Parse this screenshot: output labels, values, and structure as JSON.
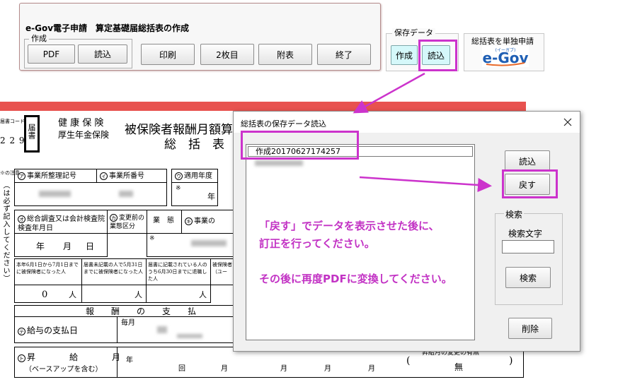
{
  "toolbar": {
    "title": "e-Gov電子申請　算定基礎届総括表の作成",
    "create_group_label": "作成",
    "pdf_label": "PDF",
    "read_label": "読込",
    "print_label": "印刷",
    "two_sheets_label": "2枚目",
    "attachment_label": "附表",
    "exit_label": "終了"
  },
  "save_data": {
    "label": "保存データ",
    "create_label": "作成",
    "read_label": "読込"
  },
  "egov_submit": {
    "label": "総括表を単独申請",
    "logo_text": "e-Gov",
    "logo_subtext": "(イーガブ)"
  },
  "form": {
    "code_label": "届書コード",
    "code_value": "2 2 9",
    "doc_type": "届書",
    "insurance_1": "健 康 保 険",
    "insurance_2": "厚生年金保険",
    "title_main": "被保険者報酬月額算",
    "title_sub": "総　括　表",
    "notes_label": "※の注意",
    "field_a": "事業所整理記号",
    "field_b": "事業所番号",
    "field_c": "適用年度",
    "field_year": "年",
    "field_e": "総合調査又は会計検査院検査年月日",
    "field_f": "変更前の業態区分",
    "field_industry": "業　態",
    "field_g": "事業の",
    "date_year": "年",
    "date_month": "月",
    "date_day": "日",
    "col1": "本年6月1日から7月1日までに被保険者になった人",
    "col2": "届書未記載の人で5月31日までに被保険者になった人",
    "col3": "届書に記載されている人のうち6月30日までに退職した人",
    "col4": "被保険者（ユー",
    "count_value": "0",
    "count_unit": "人",
    "section_salary": "報　　酬　　の　　支　　払",
    "salary_date": "給与の支払日",
    "salary_month": "毎月",
    "raise_label": "昇　　　　給　　　　月",
    "raise_sub": "（ベースアップを含む）",
    "raise_year": "年",
    "raise_times": "回",
    "raise_month": "月",
    "raise_change": "昇給月の変更の有無",
    "raise_none": "無",
    "side_text": "（は必ず記入してください）"
  },
  "dialog": {
    "title": "総括表の保存データ読込",
    "list_items": [
      "作成20170627174257"
    ],
    "read_label": "読込",
    "back_label": "戻す",
    "search_group_label": "検索",
    "search_text_label": "検索文字",
    "search_value": "",
    "search_button_label": "検索",
    "delete_label": "削除"
  },
  "overlay_note": {
    "line1": "「戻す」でデータを表示させた後に、",
    "line2": "訂正を行ってください。",
    "line3": "その後に再度PDFに変換してください。"
  },
  "colors": {
    "highlight": "#cc33cc",
    "annotation_text": "#c232c4",
    "form_header_bar": "#e8524f",
    "save_buttons": "#d5f8fa",
    "egov_logo_blue": "#1f5fb4"
  },
  "icons": {
    "close": "close-icon",
    "egov_logo": "egov-logo"
  }
}
